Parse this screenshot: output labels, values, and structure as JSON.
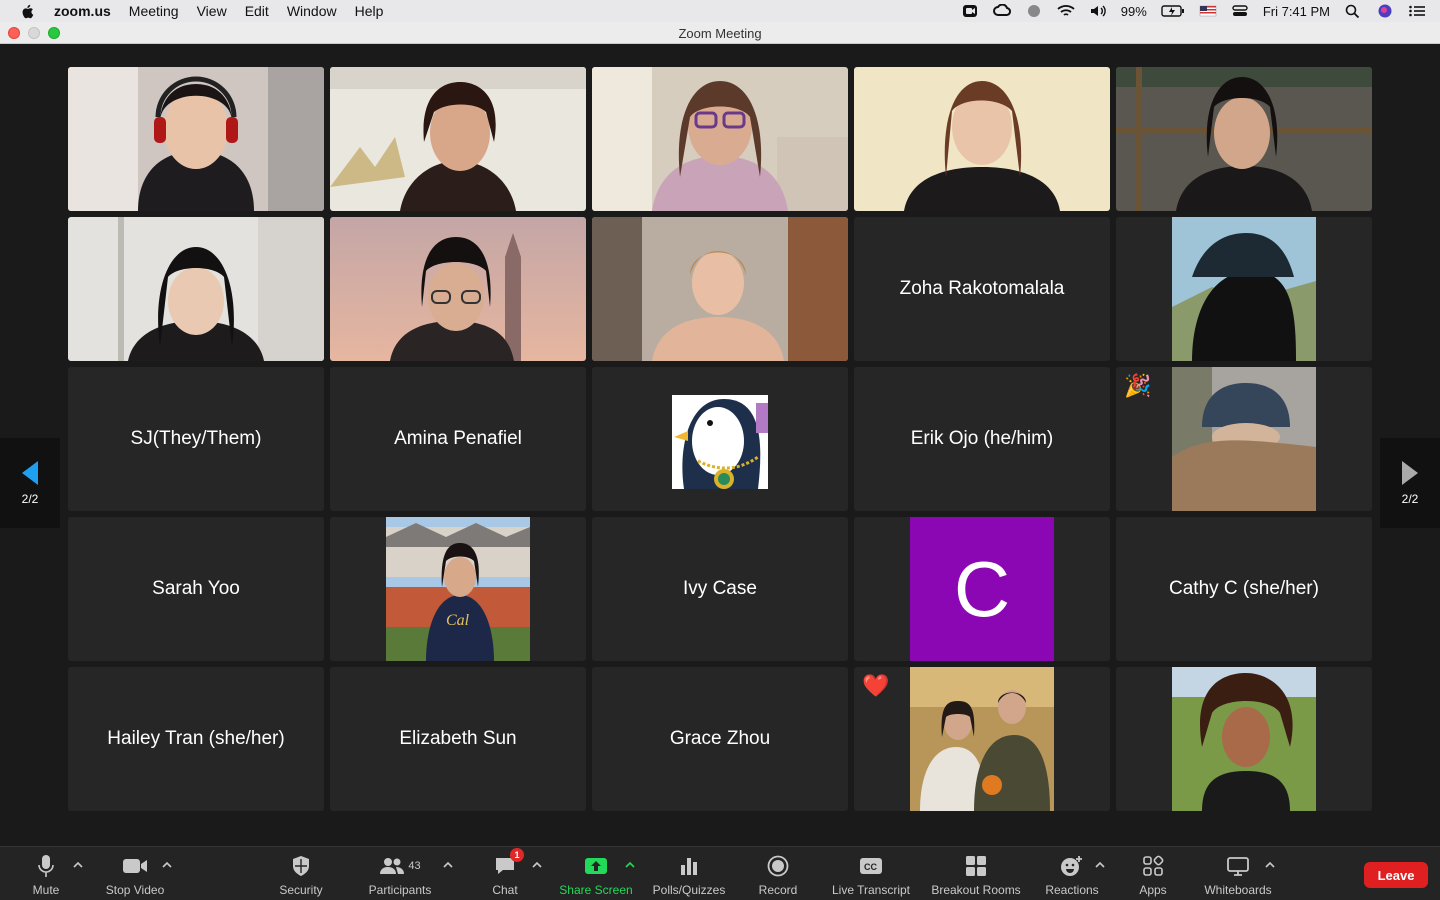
{
  "menubar": {
    "app_name": "zoom.us",
    "items": [
      "Meeting",
      "View",
      "Edit",
      "Window",
      "Help"
    ],
    "battery": "99%",
    "clock": "Fri 7:41 PM"
  },
  "window": {
    "title": "Zoom Meeting"
  },
  "pager": {
    "left_label": "2/2",
    "right_label": "2/2"
  },
  "participants": {
    "zoha": "Zoha Rakotomalala",
    "sj": "SJ(They/Them)",
    "amina": "Amina Penafiel",
    "erik": "Erik Ojo (he/him)",
    "sarah": "Sarah Yoo",
    "ivy": "Ivy Case",
    "c_avatar_letter": "C",
    "cathy": "Cathy C (she/her)",
    "hailey": "Hailey Tran (she/her)",
    "elizabeth": "Elizabeth Sun",
    "grace": "Grace Zhou"
  },
  "reactions": {
    "party": "🎉",
    "heart": "❤️"
  },
  "toolbar": {
    "mute": "Mute",
    "stop_video": "Stop Video",
    "security": "Security",
    "participants": "Participants",
    "participants_count": "43",
    "chat": "Chat",
    "chat_badge": "1",
    "share_screen": "Share Screen",
    "polls": "Polls/Quizzes",
    "record": "Record",
    "live_transcript": "Live Transcript",
    "breakout": "Breakout Rooms",
    "reactions": "Reactions",
    "apps": "Apps",
    "whiteboards": "Whiteboards",
    "leave": "Leave"
  },
  "colors": {
    "avatar_purple": "#8b07b4",
    "share_green": "#23d959",
    "leave_red": "#e02020"
  }
}
